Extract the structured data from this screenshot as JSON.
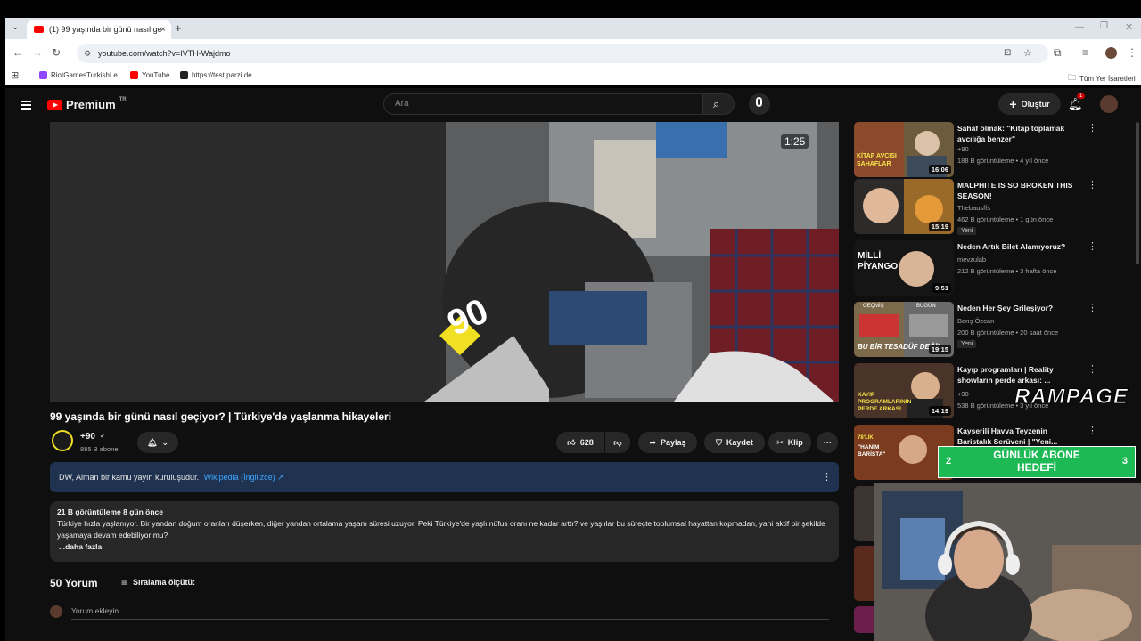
{
  "browser": {
    "tab_title": "(1) 99 yaşında bir günü nasıl ge",
    "tab_close": "×",
    "new_tab": "+",
    "url": "youtube.com/watch?v=IVTH-Wajdmo",
    "bookmarks": [
      "RiotGamesTurkishLe...",
      "YouTube",
      "https://test.parzi.de..."
    ],
    "all_bookmarks": "Tüm Yer İşaretleri"
  },
  "youtube": {
    "logo_text": "Premium",
    "logo_region": "TR",
    "search_placeholder": "Ara",
    "create_label": "Oluştur",
    "notification_count": "1"
  },
  "video": {
    "overlay_time": "1:25",
    "title": "99 yaşında bir günü nasıl geçiyor? | Türkiye'de yaşlanma hikayeleri",
    "channel_name": "+90",
    "subscribers": "885 B abone",
    "likes": "628",
    "share_label": "Paylaş",
    "save_label": "Kaydet",
    "clip_label": "Klip",
    "info_text": "DW, Alman bir kamu yayın kuruluşudur.",
    "info_link": "Wikipedia (İngilizce) ↗",
    "views_date": "21 B görüntüleme  8 gün önce",
    "description": "Türkiye hızla yaşlanıyor. Bir yandan doğum oranları düşerken, diğer yandan ortalama yaşam süresi uzuyor. Peki Türkiye'de yaşlı nüfus oranı ne kadar arttı? ve yaşlılar bu süreçte toplumsal hayattan kopmadan, yani aktif bir şekilde yaşamaya devam edebiliyor mu?",
    "more_label": "...daha fazla",
    "comments_count": "50 Yorum",
    "sort_label": "Sıralama ölçütü:",
    "comment_placeholder": "Yorum ekleyin..."
  },
  "sidebar": {
    "items": [
      {
        "title": "Sahaf olmak: \"Kitap toplamak avcılığa benzer\"",
        "channel": "+90",
        "meta": "188 B görüntüleme  •  4 yıl önce",
        "duration": "16:06",
        "badge": ""
      },
      {
        "title": "MALPHITE IS SO BROKEN THIS SEASON!",
        "channel": "Thebausffs",
        "meta": "462 B görüntüleme  •  1 gün önce",
        "duration": "15:19",
        "badge": "Yeni"
      },
      {
        "title": "Neden Artık Bilet Alamıyoruz?",
        "channel": "mevzulab",
        "meta": "212 B görüntüleme  •  3 hafta önce",
        "duration": "9:51",
        "badge": ""
      },
      {
        "title": "Neden Her Şey Grileşiyor?",
        "channel": "Barış Özcan",
        "meta": "200 B görüntüleme  •  20 saat önce",
        "duration": "19:15",
        "badge": "Yeni"
      },
      {
        "title": "Kayıp programları | Reality showların perde arkası: ...",
        "channel": "+90",
        "meta": "538 B görüntüleme  •  3 yıl önce",
        "duration": "14:19",
        "badge": ""
      },
      {
        "title": "Kayserili Havva Teyzenin Baristalık Serüveni | \"Yeni...",
        "channel": "",
        "meta": "",
        "duration": "13",
        "badge": ""
      }
    ]
  },
  "overlays": {
    "rampage": "RAMPAGE",
    "goal_left": "2",
    "goal_text_line1": "GÜNLÜK ABONE",
    "goal_text_line2": "HEDEFİ",
    "goal_right": "3"
  },
  "thumb_texts": {
    "t1": "KİTAP AVCISI SAHAFLAR",
    "t3": "MİLLİ PİYANGO",
    "t4": "BU BİR TESADÜF DEĞİL",
    "t4a": "GEÇMİŞ",
    "t4b": "BUGÜN",
    "t5": "KAYIP PROGRAMLARININ PERDE ARKASI",
    "t6": "\"HANIM BARİSTA\"",
    "t6a": "78'LİK",
    "badge90": "90"
  }
}
